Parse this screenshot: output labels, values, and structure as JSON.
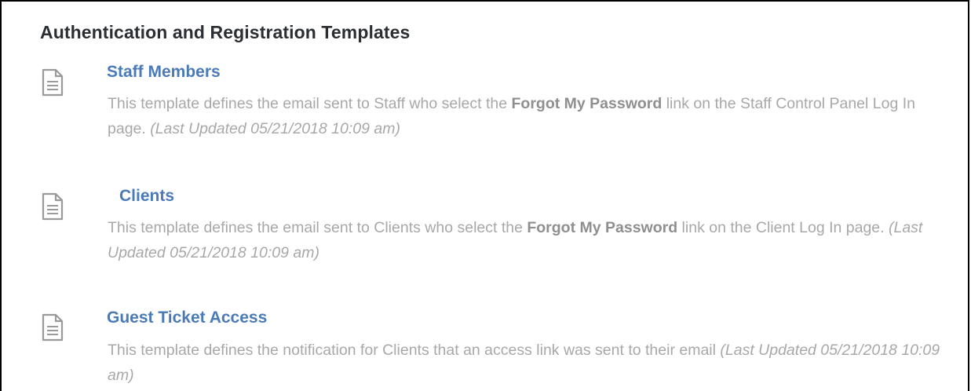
{
  "section": {
    "title": "Authentication and Registration Templates"
  },
  "templates": [
    {
      "icon": "document-icon",
      "title": "Staff Members",
      "desc_before": "This template defines the email sent to Staff who select the ",
      "desc_bold": "Forgot My Password",
      "desc_after": " link on the Staff Control Panel Log In page. ",
      "updated": "(Last Updated 05/21/2018 10:09 am)"
    },
    {
      "icon": "document-icon",
      "title": "Clients",
      "desc_before": "This template defines the email sent to Clients who select the ",
      "desc_bold": "Forgot My Password",
      "desc_after": " link on the Client Log In page. ",
      "updated": "(Last Updated 05/21/2018 10:09 am)"
    },
    {
      "icon": "document-icon",
      "title": "Guest Ticket Access",
      "desc_before": "This template defines the notification for Clients that an access link was sent to their email ",
      "desc_bold": "",
      "desc_after": "",
      "updated": "(Last Updated 05/21/2018 10:09 am)"
    }
  ]
}
